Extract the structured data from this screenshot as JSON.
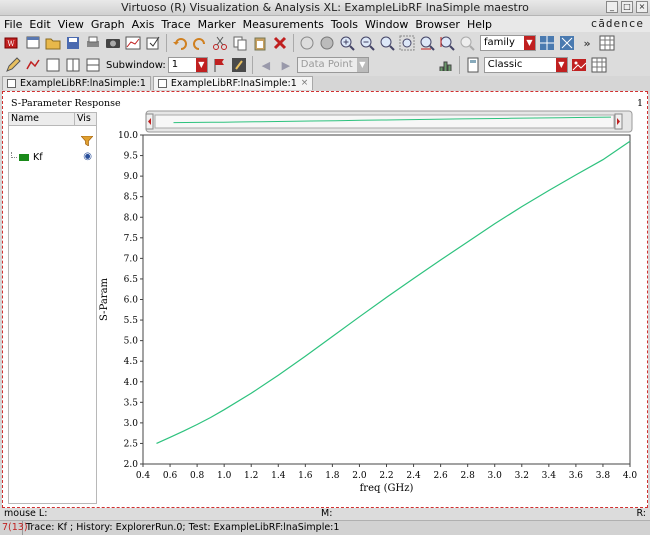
{
  "window": {
    "title": "Virtuoso (R) Visualization & Analysis XL: ExampleLibRF lnaSimple maestro",
    "brand": "cādence"
  },
  "menu": [
    "File",
    "Edit",
    "View",
    "Graph",
    "Axis",
    "Trace",
    "Marker",
    "Measurements",
    "Tools",
    "Window",
    "Browser",
    "Help"
  ],
  "toolbar": {
    "family_value": "family",
    "subwindow_label": "Subwindow:",
    "subwindow_value": "1",
    "datapoint_value": "Data Point",
    "style_value": "Classic"
  },
  "tabs": [
    {
      "label": "ExampleLibRF:lnaSimple:1",
      "active": false
    },
    {
      "label": "ExampleLibRF:lnaSimple:1",
      "active": true
    }
  ],
  "panel": {
    "title": "S-Parameter Response",
    "number": "1"
  },
  "legend": {
    "col_name": "Name",
    "col_vis": "Vis",
    "traces": [
      {
        "name": "Kf",
        "color": "#1a8a1a",
        "visible": true
      }
    ]
  },
  "chart_data": {
    "type": "line",
    "xlabel": "freq (GHz)",
    "ylabel": "S-Param",
    "xlim": [
      0.4,
      4.0
    ],
    "ylim": [
      2.0,
      10.0
    ],
    "xticks": [
      "0.4",
      "0.6",
      "0.8",
      "1.0",
      "1.2",
      "1.4",
      "1.6",
      "1.8",
      "2.0",
      "2.2",
      "2.4",
      "2.6",
      "2.8",
      "3.0",
      "3.2",
      "3.4",
      "3.6",
      "3.8",
      "4.0"
    ],
    "yticks": [
      "2.0",
      "2.5",
      "3.0",
      "3.5",
      "4.0",
      "4.5",
      "5.0",
      "5.5",
      "6.0",
      "6.5",
      "7.0",
      "7.5",
      "8.0",
      "8.5",
      "9.0",
      "9.5",
      "10.0"
    ],
    "grid": true,
    "series": [
      {
        "name": "Kf",
        "color": "#2ec27e",
        "x": [
          0.5,
          0.6,
          0.7,
          0.8,
          0.9,
          1.0,
          1.2,
          1.4,
          1.6,
          1.8,
          2.0,
          2.2,
          2.4,
          2.6,
          2.8,
          3.0,
          3.2,
          3.4,
          3.6,
          3.8,
          4.0
        ],
        "y": [
          2.5,
          2.65,
          2.8,
          2.96,
          3.13,
          3.32,
          3.72,
          4.16,
          4.62,
          5.1,
          5.58,
          6.05,
          6.51,
          6.96,
          7.4,
          7.84,
          8.26,
          8.65,
          9.03,
          9.4,
          9.85
        ]
      }
    ]
  },
  "status": {
    "mouse_l": "mouse L:",
    "mouse_m": "M:",
    "mouse_r": "R:",
    "count": "7(13)",
    "message": "Trace: Kf ; History: ExplorerRun.0; Test: ExampleLibRF:lnaSimple:1"
  },
  "colors": {
    "accent": "#c02020",
    "trace": "#2ec27e",
    "border_dash": "#d03030"
  }
}
